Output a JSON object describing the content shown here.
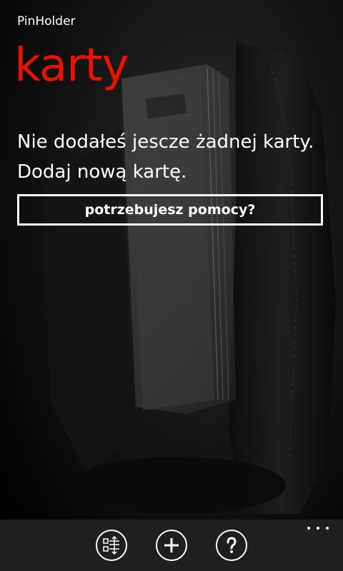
{
  "app": {
    "name": "PinHolder",
    "page_title": "karty"
  },
  "main": {
    "empty_message": "Nie dodałeś jescze żadnej karty. Dodaj nową kartę.",
    "help_button_label": "potrzebujesz pomocy?"
  },
  "appbar": {
    "buttons": [
      {
        "icon": "sort-icon"
      },
      {
        "icon": "add-icon"
      },
      {
        "icon": "help-icon"
      }
    ],
    "more_icon": "more-dots-icon"
  },
  "colors": {
    "accent": "#e51400",
    "background": "#000000",
    "appbar": "#1f1f1f",
    "text": "#ffffff"
  }
}
